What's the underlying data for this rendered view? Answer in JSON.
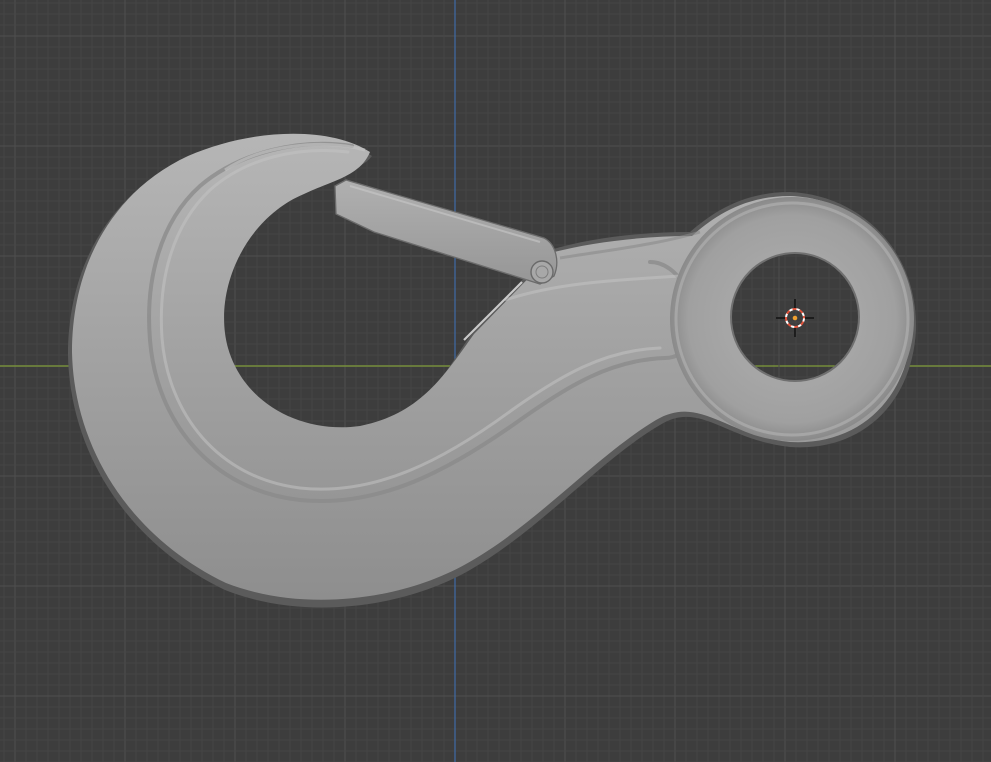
{
  "viewport": {
    "view": "orthographic-front",
    "object": "crane-hook-with-safety-latch",
    "colors": {
      "background": "#3d3d3d",
      "grid_minor": "#454545",
      "grid_major": "#4d4d4d",
      "axis_x": "#7f9c3a",
      "axis_z": "#3d6aa6",
      "mesh_fill": "#a2a2a2",
      "mesh_highlight": "#bdbdbd",
      "mesh_shadow": "#6e6e6e",
      "cursor_ring_red": "#e0533c",
      "cursor_ring_white": "#ffffff",
      "origin_dot": "#f0a030"
    },
    "icons": {
      "cursor": "3d-cursor-icon",
      "origin": "object-origin-icon"
    }
  }
}
